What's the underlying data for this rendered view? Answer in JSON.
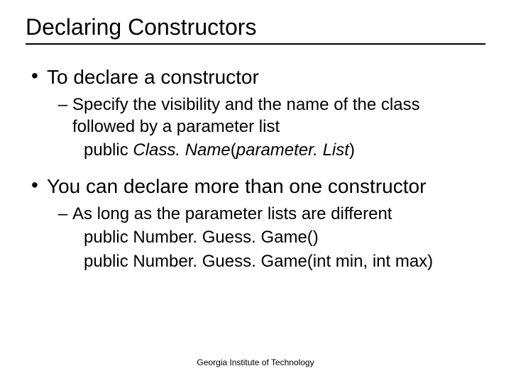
{
  "title": "Declaring Constructors",
  "b1": "To declare a constructor",
  "b1_sub": "Specify the visibility and the name of the class followed by a parameter list",
  "code1_a": "public ",
  "code1_b": "Class. Name",
  "code1_c": "(",
  "code1_d": "parameter. List",
  "code1_e": ")",
  "b2": "You can declare more than one constructor",
  "b2_sub": "As long as the parameter lists are different",
  "code2": "public Number. Guess. Game()",
  "code3": "public Number. Guess. Game(int min, int max)",
  "footer": "Georgia Institute of Technology"
}
